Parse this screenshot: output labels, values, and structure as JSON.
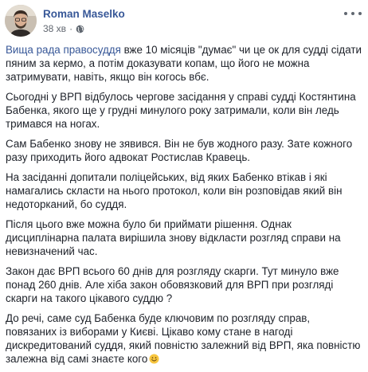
{
  "post": {
    "author": "Roman Maselko",
    "time": "38 хв",
    "dot": "·",
    "paragraphs": [
      {
        "link": "Вища рада правосуддя",
        "text": " вже 10 місяців \"думає\" чи це ок для судді сідати пяним за кермо, а потім доказувати копам, що його не можна затримувати, навіть, якщо він когось вбє."
      },
      {
        "text": "Сьогодні у ВРП відбулось чергове засідання у справі судді Костянтина Бабенка, якого ще у грудні минулого року затримали, коли він ледь тримався на ногах."
      },
      {
        "text": "Сам Бабенко знову не зявився. Він не був жодного разу. Зате кожного разу приходить його адвокат Ростислав Кравець."
      },
      {
        "text": "На засіданні допитали поліцейських, від яких Бабенко втікав і які намагались скласти на нього протокол, коли він розповідав який він недоторканий, бо суддя."
      },
      {
        "text": "Після цього вже можна було би приймати рішення. Однак дисциплінарна палата вирішила знову відкласти розгляд справи на невизначений час."
      },
      {
        "text": "Закон дає ВРП всього 60 днів для розгляду скарги. Тут минуло вже понад 260 днів. Але хіба закон обовязковий для ВРП при розгляді скарги на такого цікавого суддю ?"
      },
      {
        "text": "До речі, саме суд Бабенка буде ключовим по розгляду справ, повязаних із виборами у Києві. Цікаво кому стане в нагоді дискредитований суддя, який повністю залежний від ВРП, яка повністю залежна від самі знаєте кого"
      }
    ],
    "emoji": "smile-emoji"
  }
}
